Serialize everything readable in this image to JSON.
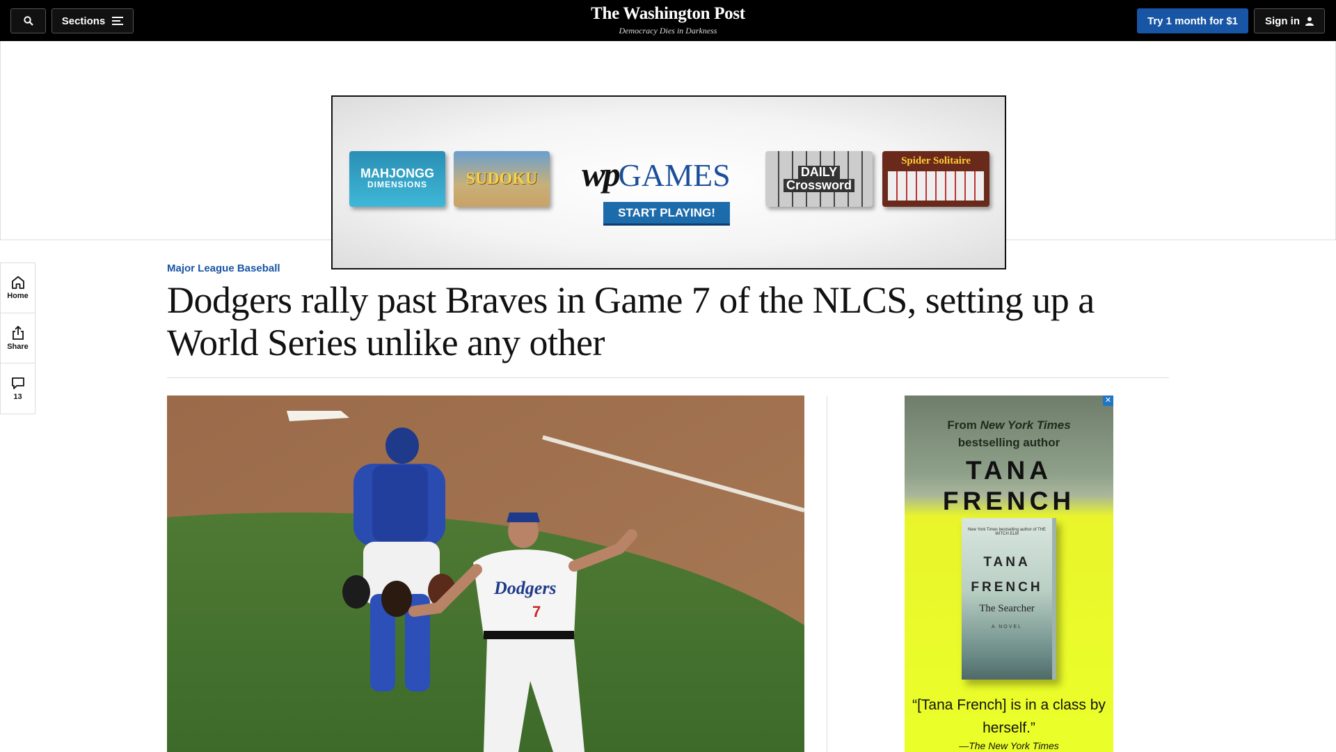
{
  "topbar": {
    "sections_label": "Sections",
    "logo_text": "The Washington Post",
    "tagline": "Democracy Dies in Darkness",
    "try_label": "Try 1 month for $1",
    "signin_label": "Sign in"
  },
  "top_ad": {
    "mahjongg_title": "MAHJONGG",
    "mahjongg_sub": "DIMENSIONS",
    "sudoku": "SUDOKU",
    "wp": "wp",
    "games": "GAMES",
    "start": "START PLAYING!",
    "crossword_1": "DAILY",
    "crossword_2": "Crossword",
    "spider": "Spider Solitaire"
  },
  "rail": {
    "home": "Home",
    "share": "Share",
    "comments": "13"
  },
  "article": {
    "kicker": "Major League Baseball",
    "headline": "Dodgers rally past Braves in Game 7 of the NLCS, setting up a World Series unlike any other"
  },
  "side_ad": {
    "from_prefix": "From ",
    "from_em": "New York Times",
    "from_line2": "bestselling author",
    "author_1": "TANA",
    "author_2": "FRENCH",
    "book_blurb": "New York Times bestselling author of THE WITCH ELM",
    "book_author_1": "TANA",
    "book_author_2": "FRENCH",
    "book_title": "The Searcher",
    "book_novel": "A NOVEL",
    "quote": "“[Tana French] is in a class by herself.”",
    "source": "—The New York Times"
  },
  "colors": {
    "brand_blue": "#1955a5",
    "topbar": "#000000"
  }
}
